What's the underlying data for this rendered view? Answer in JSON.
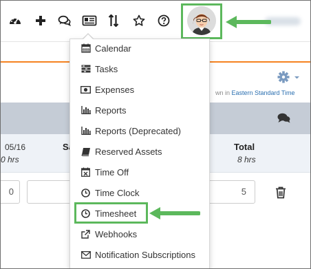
{
  "colors": {
    "accent_green": "#5cb85c",
    "orange_rule": "#f58220",
    "link_blue": "#2a6fb0",
    "gray_bar": "#c5ccd6"
  },
  "topnav": {
    "icons": [
      "dashboard-icon",
      "plus-icon",
      "chat-icon",
      "expenses-card-icon",
      "sort-icon",
      "star-icon",
      "help-icon",
      "avatar-icon"
    ]
  },
  "timezone_note": {
    "prefix": "wn in ",
    "timezone": "Eastern Standard Time"
  },
  "timesheet_header": {
    "date_fragment": "05/16",
    "hours_fragment": "0 hrs",
    "day_fragment": "Sa",
    "total_label": "Total",
    "total_hours": "8 hrs"
  },
  "row": {
    "left_value": "0",
    "right_value": "5"
  },
  "menu": {
    "items": [
      {
        "label": "Calendar",
        "icon": "calendar-icon"
      },
      {
        "label": "Tasks",
        "icon": "tasks-icon"
      },
      {
        "label": "Expenses",
        "icon": "money-icon"
      },
      {
        "label": "Reports",
        "icon": "bar-chart-icon"
      },
      {
        "label": "Reports (Deprecated)",
        "icon": "bar-chart-icon"
      },
      {
        "label": "Reserved Assets",
        "icon": "book-icon"
      },
      {
        "label": "Time Off",
        "icon": "calendar-x-icon"
      },
      {
        "label": "Time Clock",
        "icon": "clock-icon"
      },
      {
        "label": "Timesheet",
        "icon": "clock-icon"
      },
      {
        "label": "Webhooks",
        "icon": "external-link-icon"
      },
      {
        "label": "Notification Subscriptions",
        "icon": "envelope-icon"
      }
    ]
  }
}
